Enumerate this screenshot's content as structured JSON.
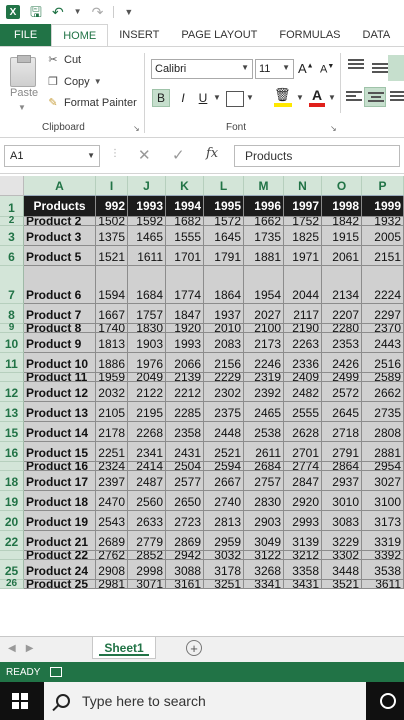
{
  "quick_access": {
    "app_icon": "excel-icon",
    "save_icon": "save-icon",
    "undo_icon": "undo-icon",
    "redo_icon": "redo-icon",
    "customize_icon": "customize-qat-icon"
  },
  "ribbon_tabs": [
    "FILE",
    "HOME",
    "INSERT",
    "PAGE LAYOUT",
    "FORMULAS",
    "DATA"
  ],
  "active_tab": "HOME",
  "clipboard": {
    "paste_label": "Paste",
    "cut_label": "Cut",
    "copy_label": "Copy",
    "format_painter_label": "Format Painter",
    "group_label": "Clipboard"
  },
  "font": {
    "font_name": "Calibri",
    "font_size": "11",
    "grow_label": "A",
    "shrink_label": "A",
    "bold_label": "B",
    "italic_label": "I",
    "underline_label": "U",
    "font_color_label": "A",
    "group_label": "Font",
    "highlight_color": "#FFE800",
    "font_color": "#E0201B"
  },
  "formula_bar": {
    "name_box": "A1",
    "fx_label": "fx",
    "formula_value": "Products"
  },
  "columns": [
    "A",
    "I",
    "J",
    "K",
    "L",
    "M",
    "N",
    "O",
    "P"
  ],
  "header_row": {
    "row_num": "1",
    "cells": [
      "Products",
      "992",
      "1993",
      "1994",
      "1995",
      "1996",
      "1997",
      "1998",
      "1999"
    ]
  },
  "rows": [
    {
      "num": "2",
      "kind": "squashed",
      "cells": [
        "Product 2",
        "1502",
        "1592",
        "1682",
        "1572",
        "1662",
        "1752",
        "1842",
        "1932"
      ]
    },
    {
      "num": "3",
      "kind": "normal",
      "cells": [
        "Product 3",
        "1375",
        "1465",
        "1555",
        "1645",
        "1735",
        "1825",
        "1915",
        "2005"
      ]
    },
    {
      "num": "6",
      "kind": "normal",
      "cells": [
        "Product 5",
        "1521",
        "1611",
        "1701",
        "1791",
        "1881",
        "1971",
        "2061",
        "2151"
      ]
    },
    {
      "num": "7",
      "kind": "tall",
      "cells": [
        "Product 6",
        "1594",
        "1684",
        "1774",
        "1864",
        "1954",
        "2044",
        "2134",
        "2224"
      ]
    },
    {
      "num": "8",
      "kind": "normal",
      "cells": [
        "Product 7",
        "1667",
        "1757",
        "1847",
        "1937",
        "2027",
        "2117",
        "2207",
        "2297"
      ]
    },
    {
      "num": "9",
      "kind": "squashed",
      "cells": [
        "Product 8",
        "1740",
        "1830",
        "1920",
        "2010",
        "2100",
        "2190",
        "2280",
        "2370"
      ]
    },
    {
      "num": "10",
      "kind": "normal",
      "cells": [
        "Product 9",
        "1813",
        "1903",
        "1993",
        "2083",
        "2173",
        "2263",
        "2353",
        "2443"
      ]
    },
    {
      "num": "11",
      "kind": "normal",
      "cells": [
        "Product 10",
        "1886",
        "1976",
        "2066",
        "2156",
        "2246",
        "2336",
        "2426",
        "2516"
      ]
    },
    {
      "num": "",
      "kind": "squashed",
      "cells": [
        "Product 11",
        "1959",
        "2049",
        "2139",
        "2229",
        "2319",
        "2409",
        "2499",
        "2589"
      ]
    },
    {
      "num": "12",
      "kind": "normal",
      "cells": [
        "Product 12",
        "2032",
        "2122",
        "2212",
        "2302",
        "2392",
        "2482",
        "2572",
        "2662"
      ]
    },
    {
      "num": "13",
      "kind": "normal",
      "cells": [
        "Product 13",
        "2105",
        "2195",
        "2285",
        "2375",
        "2465",
        "2555",
        "2645",
        "2735"
      ]
    },
    {
      "num": "15",
      "kind": "normal",
      "cells": [
        "Product 14",
        "2178",
        "2268",
        "2358",
        "2448",
        "2538",
        "2628",
        "2718",
        "2808"
      ]
    },
    {
      "num": "16",
      "kind": "normal",
      "cells": [
        "Product 15",
        "2251",
        "2341",
        "2431",
        "2521",
        "2611",
        "2701",
        "2791",
        "2881"
      ]
    },
    {
      "num": "",
      "kind": "squashed",
      "cells": [
        "Product 16",
        "2324",
        "2414",
        "2504",
        "2594",
        "2684",
        "2774",
        "2864",
        "2954"
      ]
    },
    {
      "num": "18",
      "kind": "normal",
      "cells": [
        "Product 17",
        "2397",
        "2487",
        "2577",
        "2667",
        "2757",
        "2847",
        "2937",
        "3027"
      ]
    },
    {
      "num": "19",
      "kind": "normal",
      "cells": [
        "Product 18",
        "2470",
        "2560",
        "2650",
        "2740",
        "2830",
        "2920",
        "3010",
        "3100"
      ]
    },
    {
      "num": "20",
      "kind": "normal",
      "cells": [
        "Product 19",
        "2543",
        "2633",
        "2723",
        "2813",
        "2903",
        "2993",
        "3083",
        "3173"
      ]
    },
    {
      "num": "22",
      "kind": "normal",
      "cells": [
        "Product 21",
        "2689",
        "2779",
        "2869",
        "2959",
        "3049",
        "3139",
        "3229",
        "3319"
      ]
    },
    {
      "num": "",
      "kind": "squashed",
      "cells": [
        "Product 22",
        "2762",
        "2852",
        "2942",
        "3032",
        "3122",
        "3212",
        "3302",
        "3392"
      ]
    },
    {
      "num": "25",
      "kind": "normal",
      "cells": [
        "Product 24",
        "2908",
        "2998",
        "3088",
        "3178",
        "3268",
        "3358",
        "3448",
        "3538"
      ]
    },
    {
      "num": "26",
      "kind": "squashed",
      "cells": [
        "Product 25",
        "2981",
        "3071",
        "3161",
        "3251",
        "3341",
        "3431",
        "3521",
        "3611"
      ]
    }
  ],
  "sheet_tabs": [
    "Sheet1"
  ],
  "add_sheet_label": "+",
  "status": "READY",
  "taskbar": {
    "search_placeholder": "Type here to search"
  },
  "colors": {
    "excel_green": "#217346",
    "header_fill": "#1C1C1C",
    "selection_fill": "#D0D0D0"
  }
}
